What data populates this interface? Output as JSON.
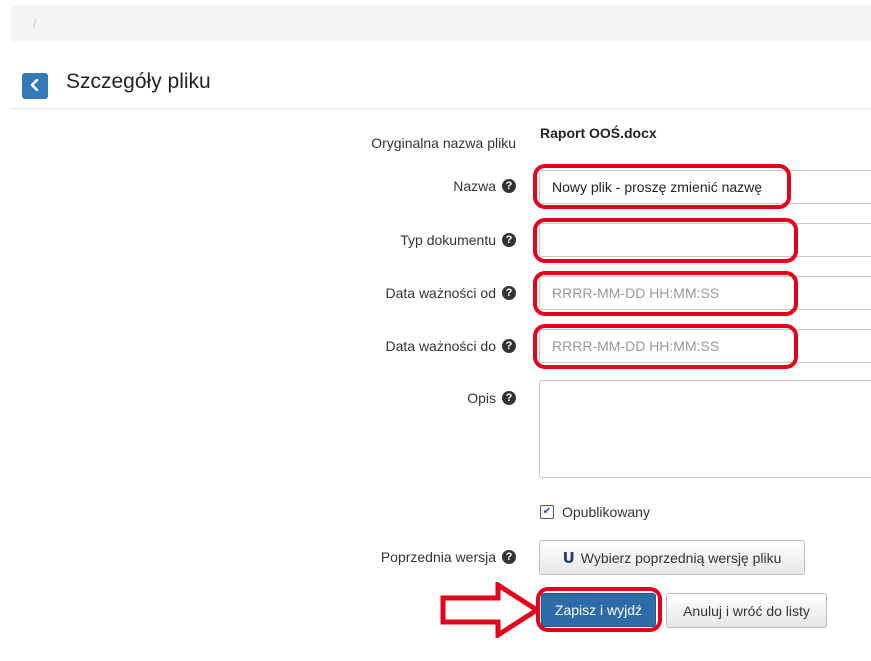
{
  "breadcrumb": {
    "separator": "/"
  },
  "header": {
    "back_icon": "chevron-left-icon",
    "title": "Szczegóły pliku"
  },
  "form": {
    "original_name_label": "Oryginalna nazwa pliku",
    "original_name_value": "Raport OOŚ.docx",
    "name_label": "Nazwa",
    "name_value": "Nowy plik - proszę zmienić nazwę",
    "doc_type_label": "Typ dokumentu",
    "doc_type_value": "",
    "valid_from_label": "Data ważności od",
    "valid_from_placeholder": "RRRR-MM-DD HH:MM:SS",
    "valid_to_label": "Data ważności do",
    "valid_to_placeholder": "RRRR-MM-DD HH:MM:SS",
    "description_label": "Opis",
    "description_value": "",
    "published_label": "Opublikowany",
    "published_checked": true,
    "previous_version_label": "Poprzednia wersja",
    "previous_version_button": "Wybierz poprzednią wersję pliku"
  },
  "actions": {
    "save_exit": "Zapisz i wyjdź",
    "cancel_back": "Anuluj i wróć do listy"
  },
  "help_icon": "question-circle-icon",
  "colors": {
    "primary": "#2d6ca8",
    "annotation": "#e3001b"
  }
}
